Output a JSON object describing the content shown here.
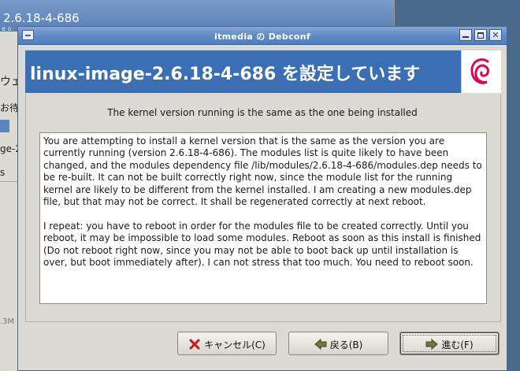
{
  "background_window": {
    "title_fragment": "2.6.18-4-686",
    "subtitle_fragment": "e o",
    "fragments": [
      "ウェ",
      "お待",
      "ge-2",
      "s",
      ".3M"
    ]
  },
  "dialog": {
    "title": "itmedia の Debconf",
    "banner_title": "linux-image-2.6.18-4-686 を設定しています",
    "subtitle": "The kernel version running is the same as the one being installed",
    "paragraphs": [
      "You are attempting to install a kernel version that is the same as the version you are currently running (version 2.6.18-4-686). The modules list is quite likely to have been changed, and the modules dependency file /lib/modules/2.6.18-4-686/modules.dep needs to be re-built. It can not be built correctly right now, since the module list for the running kernel are likely to be different from the kernel installed. I am creating a new modules.dep file, but that may not be correct. It shall be regenerated correctly at next reboot.",
      "I repeat: you have to reboot in order for the modules file to be created correctly. Until you reboot, it may be impossible to load some modules. Reboot as soon as this install is finished (Do not reboot right now, since you may not be able to boot back up until installation is over, but boot immediately after). I can not stress that too much. You need to reboot soon."
    ],
    "buttons": {
      "cancel": "キャンセル(C)",
      "back": "戻る(B)",
      "forward": "進む(F)"
    }
  },
  "colors": {
    "titlebar": "#5f88c4",
    "banner": "#3c6eb4",
    "debian_swirl": "#d70751"
  },
  "icons": {
    "window_menu": "window-menu-icon",
    "minimize": "minimize-icon",
    "maximize": "maximize-icon",
    "close": "close-icon",
    "logo": "debian-logo",
    "cancel": "cancel-x-icon",
    "back": "back-arrow-icon",
    "forward": "forward-arrow-icon"
  }
}
